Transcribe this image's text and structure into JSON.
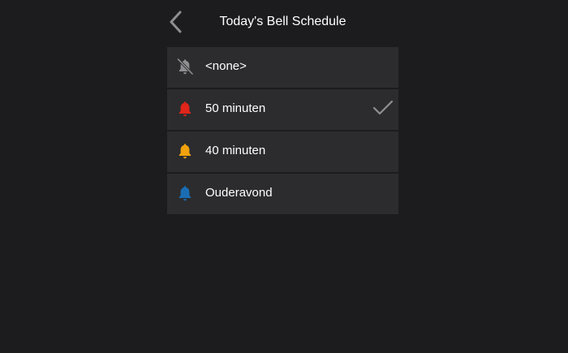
{
  "header": {
    "title": "Today's Bell Schedule",
    "back_icon": "chevron-left-icon"
  },
  "schedules": [
    {
      "label": "<none>",
      "icon": "bell-off-icon",
      "color": "#8e8e93",
      "selected": false
    },
    {
      "label": "50 minuten",
      "icon": "bell-icon",
      "color": "#e0251b",
      "selected": true
    },
    {
      "label": "40 minuten",
      "icon": "bell-icon",
      "color": "#f2a20d",
      "selected": false
    },
    {
      "label": "Ouderavond",
      "icon": "bell-icon",
      "color": "#1a6db3",
      "selected": false
    }
  ],
  "colors": {
    "background": "#1c1c1e",
    "row": "#2c2c2e",
    "checkmark": "#8e8e93"
  }
}
